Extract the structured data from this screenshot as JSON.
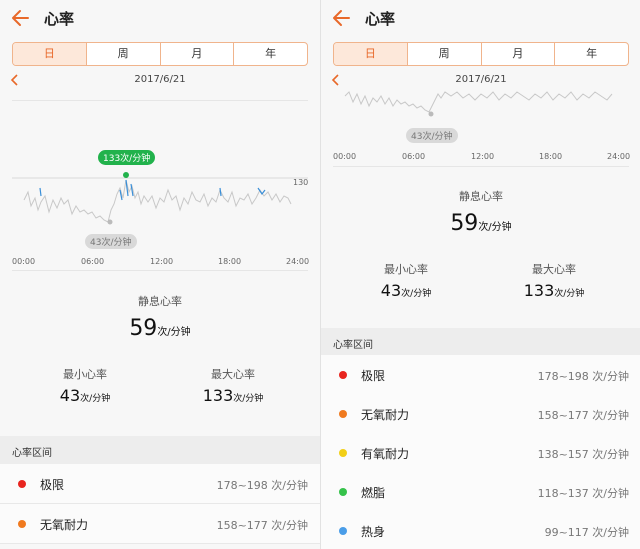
{
  "header": {
    "title": "心率"
  },
  "tabs": [
    "日",
    "周",
    "月",
    "年"
  ],
  "date": "2017/6/21",
  "chart": {
    "x_ticks": [
      "00:00",
      "06:00",
      "12:00",
      "18:00",
      "24:00"
    ],
    "y_ref_label": "130",
    "max_tag": "133次/分钟",
    "min_tag": "43次/分钟"
  },
  "resting": {
    "label": "静息心率",
    "value": "59",
    "unit": "次/分钟"
  },
  "min": {
    "label": "最小心率",
    "value": "43",
    "unit": "次/分钟"
  },
  "max": {
    "label": "最大心率",
    "value": "133",
    "unit": "次/分钟"
  },
  "zones_title": "心率区间",
  "zones": [
    {
      "name": "极限",
      "range": "178~198 次/分钟",
      "color": "#e8251f"
    },
    {
      "name": "无氧耐力",
      "range": "158~177 次/分钟",
      "color": "#f07a1f"
    },
    {
      "name": "有氧耐力",
      "range": "138~157 次/分钟",
      "color": "#f2cf17"
    },
    {
      "name": "燃脂",
      "range": "118~137 次/分钟",
      "color": "#35c24a"
    },
    {
      "name": "热身",
      "range": "99~117 次/分钟",
      "color": "#4a9de8"
    }
  ],
  "colors": {
    "accent": "#e8692a",
    "peak": "#22b24c",
    "line": "#c8c8c8",
    "spike": "#3a8fd8"
  }
}
